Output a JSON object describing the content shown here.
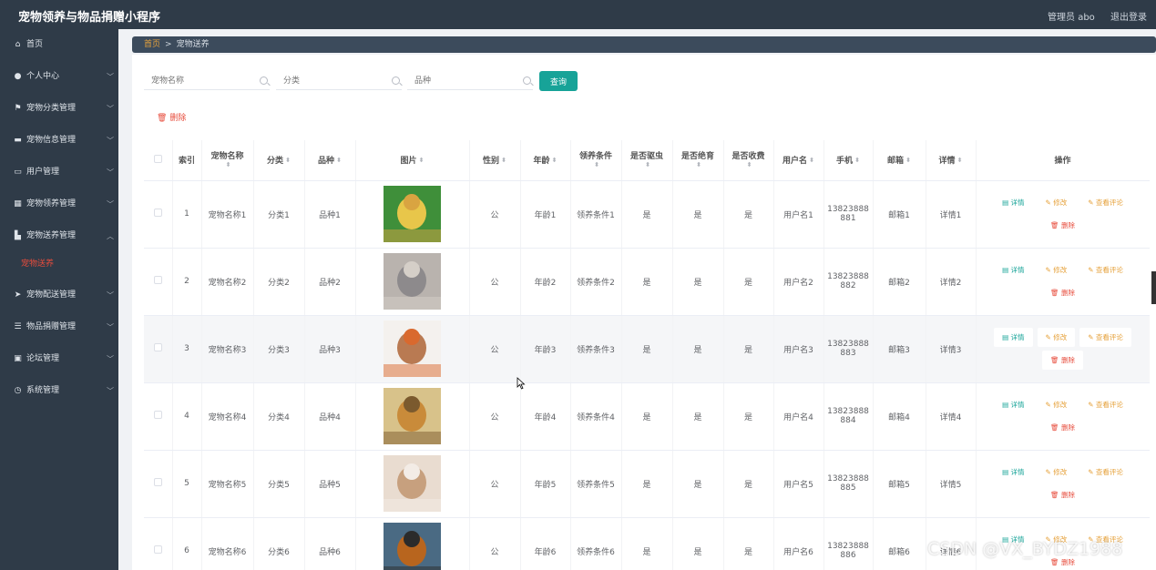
{
  "app": {
    "title": "宠物领养与物品捐赠小程序"
  },
  "topbar": {
    "user_label": "管理员 abo",
    "logout_label": "退出登录"
  },
  "sidebar": {
    "items": [
      {
        "label": "首页",
        "icon": "home-icon"
      },
      {
        "label": "个人中心",
        "icon": "user-icon"
      },
      {
        "label": "宠物分类管理",
        "icon": "flag-icon"
      },
      {
        "label": "宠物信息管理",
        "icon": "chat-icon"
      },
      {
        "label": "用户管理",
        "icon": "message-icon"
      },
      {
        "label": "宠物领养管理",
        "icon": "grid-icon"
      },
      {
        "label": "宠物送养管理",
        "icon": "box-icon"
      },
      {
        "label": "宠物配送管理",
        "icon": "send-icon"
      },
      {
        "label": "物品捐赠管理",
        "icon": "sliders-icon"
      },
      {
        "label": "论坛管理",
        "icon": "edit-icon"
      },
      {
        "label": "系统管理",
        "icon": "clock-icon"
      }
    ],
    "submenu_active": "宠物送养"
  },
  "breadcrumb": {
    "home": "首页",
    "separator": ">",
    "current": "宠物送养"
  },
  "search": {
    "name_placeholder": "宠物名称",
    "category_placeholder": "分类",
    "breed_placeholder": "品种",
    "query_label": "查询"
  },
  "toolbar": {
    "delete_label": "删除"
  },
  "table": {
    "headers": [
      "索引",
      "宠物名称",
      "分类",
      "品种",
      "图片",
      "性别",
      "年龄",
      "领养条件",
      "是否驱虫",
      "是否绝育",
      "是否收费",
      "用户名",
      "手机",
      "邮箱",
      "详情",
      "操作"
    ],
    "rows": [
      {
        "index": "1",
        "name": "宠物名称1",
        "category": "分类1",
        "breed": "品种1",
        "gender": "公",
        "age": "年龄1",
        "condition": "领养条件1",
        "dewormed": "是",
        "sterilized": "是",
        "charged": "是",
        "username": "用户名1",
        "phone_a": "13823888",
        "phone_b": "881",
        "email": "邮箱1",
        "detail": "详情1"
      },
      {
        "index": "2",
        "name": "宠物名称2",
        "category": "分类2",
        "breed": "品种2",
        "gender": "公",
        "age": "年龄2",
        "condition": "领养条件2",
        "dewormed": "是",
        "sterilized": "是",
        "charged": "是",
        "username": "用户名2",
        "phone_a": "13823888",
        "phone_b": "882",
        "email": "邮箱2",
        "detail": "详情2"
      },
      {
        "index": "3",
        "name": "宠物名称3",
        "category": "分类3",
        "breed": "品种3",
        "gender": "公",
        "age": "年龄3",
        "condition": "领养条件3",
        "dewormed": "是",
        "sterilized": "是",
        "charged": "是",
        "username": "用户名3",
        "phone_a": "13823888",
        "phone_b": "883",
        "email": "邮箱3",
        "detail": "详情3"
      },
      {
        "index": "4",
        "name": "宠物名称4",
        "category": "分类4",
        "breed": "品种4",
        "gender": "公",
        "age": "年龄4",
        "condition": "领养条件4",
        "dewormed": "是",
        "sterilized": "是",
        "charged": "是",
        "username": "用户名4",
        "phone_a": "13823888",
        "phone_b": "884",
        "email": "邮箱4",
        "detail": "详情4"
      },
      {
        "index": "5",
        "name": "宠物名称5",
        "category": "分类5",
        "breed": "品种5",
        "gender": "公",
        "age": "年龄5",
        "condition": "领养条件5",
        "dewormed": "是",
        "sterilized": "是",
        "charged": "是",
        "username": "用户名5",
        "phone_a": "13823888",
        "phone_b": "885",
        "email": "邮箱5",
        "detail": "详情5"
      },
      {
        "index": "6",
        "name": "宠物名称6",
        "category": "分类6",
        "breed": "品种6",
        "gender": "公",
        "age": "年龄6",
        "condition": "领养条件6",
        "dewormed": "是",
        "sterilized": "是",
        "charged": "是",
        "username": "用户名6",
        "phone_a": "13823888",
        "phone_b": "886",
        "email": "邮箱6",
        "detail": "详情6"
      }
    ],
    "actions": {
      "detail": "详情",
      "edit": "修改",
      "comment": "查看评论",
      "delete": "删除"
    }
  },
  "watermark": "CSDN @VX_BYDZ1988",
  "colors": {
    "sidebar_bg": "#2f3b48",
    "accent": "#17a398",
    "danger": "#e74c3c",
    "warning": "#e6a23c"
  }
}
